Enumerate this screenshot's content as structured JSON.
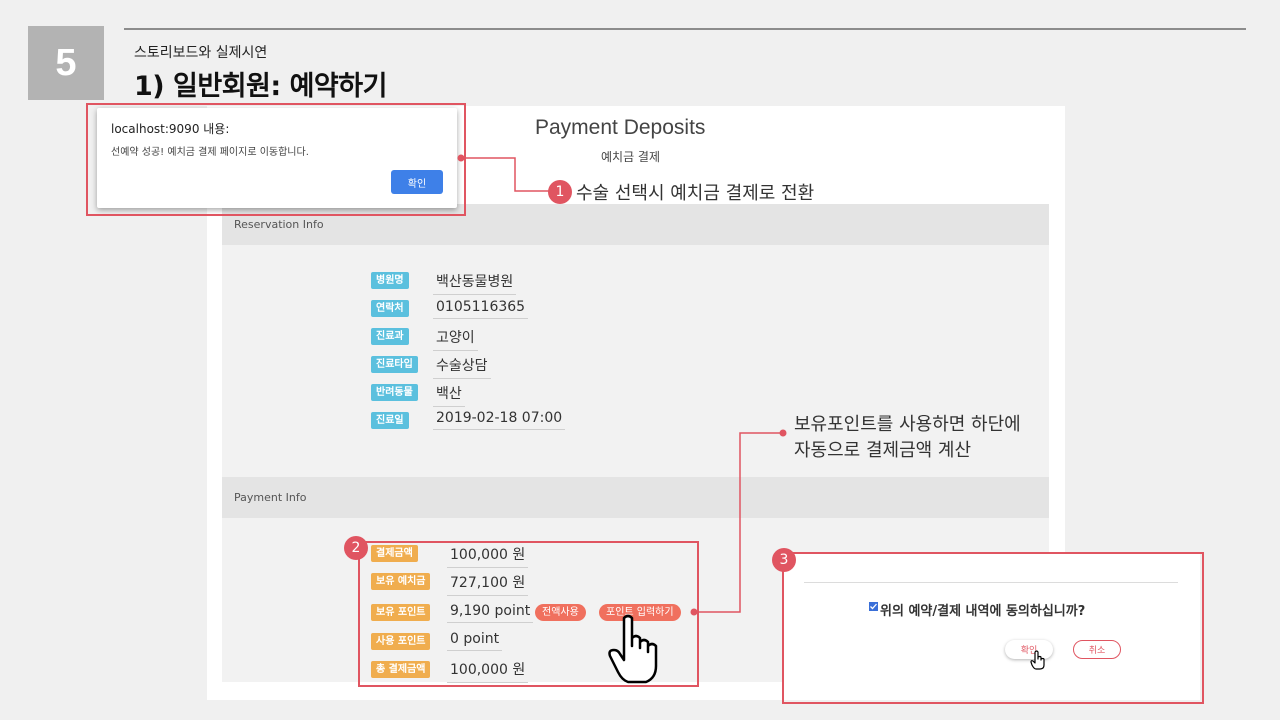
{
  "slide": {
    "number": "5",
    "subtitle": "스토리보드와 실제시연",
    "heading": "1) 일반회원: 예약하기"
  },
  "page": {
    "title": "Payment Deposits",
    "subtitle": "예치금 결제"
  },
  "reservation": {
    "section_title": "Reservation Info",
    "rows": [
      {
        "label": "병원명",
        "value": "백산동물병원"
      },
      {
        "label": "연락처",
        "value": "0105116365"
      },
      {
        "label": "진료과",
        "value": "고양이"
      },
      {
        "label": "진료타입",
        "value": "수술상담"
      },
      {
        "label": "반려동물",
        "value": "백산"
      },
      {
        "label": "진료일",
        "value": "2019-02-18 07:00"
      }
    ]
  },
  "payment": {
    "section_title": "Payment Info",
    "rows": [
      {
        "label": "결제금액",
        "value": "100,000",
        "unit": "원"
      },
      {
        "label": "보유 예치금",
        "value": "727,100",
        "unit": "원"
      },
      {
        "label": "보유 포인트",
        "value": "9,190",
        "unit": "point"
      },
      {
        "label": "사용 포인트",
        "value": "0",
        "unit": "point"
      },
      {
        "label": "총 결제금액",
        "value": "100,000",
        "unit": "원"
      }
    ],
    "use_all_button": "전액사용",
    "enter_points_button": "포인트 입력하기"
  },
  "dialog": {
    "origin": "localhost:9090 내용:",
    "message": "선예약 성공! 예치금 결제 페이지로 이동합니다.",
    "ok_button": "확인"
  },
  "annotations": {
    "badge_1": "1",
    "text_1": "수술 선택시 예치금 결제로 전환",
    "badge_2": "2",
    "badge_3": "3",
    "text_2_line1": "보유포인트를 사용하면 하단에",
    "text_2_line2": "자동으로 결제금액 계산"
  },
  "confirm": {
    "agree_text": "위의 예약/결제 내역에 동의하십니까?",
    "agree_checked": true,
    "ok_button": "확인",
    "cancel_button": "취소"
  },
  "colors": {
    "accent_red": "#e05561",
    "label_blue": "#5bc0de",
    "label_orange": "#f0ad4e",
    "pill_red": "#f0705e",
    "dialog_button": "#3e80e8"
  },
  "icons": [
    "hand-pointer-icon",
    "cursor-hand-icon",
    "checkbox-icon"
  ]
}
